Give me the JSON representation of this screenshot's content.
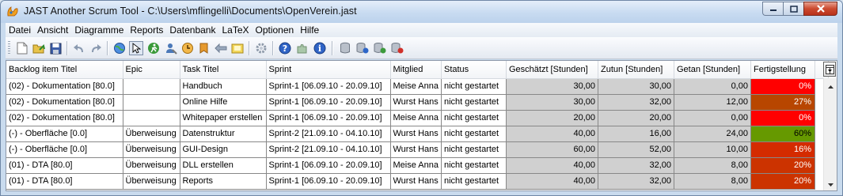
{
  "window": {
    "title": "JAST Another Scrum Tool  -  C:\\Users\\mflingelli\\Documents\\OpenVerein.jast"
  },
  "colors": {
    "titlebar": "#c8dbf1",
    "numeric_cell_bg": "#d0d0d0",
    "progress_0": "#ff0000",
    "progress_16": "#d42b00",
    "progress_20": "#cc3300",
    "progress_27": "#b84600",
    "progress_60": "#669900"
  },
  "menu": [
    "Datei",
    "Ansicht",
    "Diagramme",
    "Reports",
    "Datenbank",
    "LaTeX",
    "Optionen",
    "Hilfe"
  ],
  "toolbar": {
    "icons": [
      "new-file-icon",
      "open-folder-icon",
      "save-icon",
      "undo-icon",
      "redo-icon",
      "globe-icon",
      "cursor-select-icon",
      "run-person-icon",
      "user-config-icon",
      "clock-icon",
      "bookmark-icon",
      "transfer-icon",
      "folder-note-icon",
      "gear-icon",
      "help-icon",
      "puzzle-icon",
      "info-icon",
      "database-icon",
      "database-add-icon",
      "database-refresh-icon",
      "database-delete-icon"
    ]
  },
  "table": {
    "headers": [
      "Backlog item Titel",
      "Epic",
      "Task Titel",
      "Sprint",
      "Mitglied",
      "Status",
      "Geschätzt [Stunden]",
      "Zutun [Stunden]",
      "Getan [Stunden]",
      "Fertigstellung"
    ],
    "rows": [
      {
        "backlog": "(02) - Dokumentation [80.0]",
        "epic": "",
        "task": "Handbuch",
        "sprint": "Sprint-1 [06.09.10 - 20.09.10]",
        "member": "Meise Anna",
        "status": "nicht gestartet",
        "estimated": "30,00",
        "todo": "30,00",
        "done": "0,00",
        "progress": "0%",
        "progress_value": 0,
        "progress_color": "#ff0000"
      },
      {
        "backlog": "(02) - Dokumentation [80.0]",
        "epic": "",
        "task": "Online Hilfe",
        "sprint": "Sprint-1 [06.09.10 - 20.09.10]",
        "member": "Wurst Hans",
        "status": "nicht gestartet",
        "estimated": "30,00",
        "todo": "32,00",
        "done": "12,00",
        "progress": "27%",
        "progress_value": 27,
        "progress_color": "#b84600"
      },
      {
        "backlog": "(02) - Dokumentation [80.0]",
        "epic": "",
        "task": "Whitepaper erstellen",
        "sprint": "Sprint-1 [06.09.10 - 20.09.10]",
        "member": "Meise Anna",
        "status": "nicht gestartet",
        "estimated": "20,00",
        "todo": "20,00",
        "done": "0,00",
        "progress": "0%",
        "progress_value": 0,
        "progress_color": "#ff0000"
      },
      {
        "backlog": "(-) - Oberfläche [0.0]",
        "epic": "Überweisung",
        "task": "Datenstruktur",
        "sprint": "Sprint-2 [21.09.10 - 04.10.10]",
        "member": "Wurst Hans",
        "status": "nicht gestartet",
        "estimated": "40,00",
        "todo": "16,00",
        "done": "24,00",
        "progress": "60%",
        "progress_value": 60,
        "progress_color": "#669900"
      },
      {
        "backlog": "(-) - Oberfläche [0.0]",
        "epic": "Überweisung",
        "task": "GUI-Design",
        "sprint": "Sprint-2 [21.09.10 - 04.10.10]",
        "member": "Wurst Hans",
        "status": "nicht gestartet",
        "estimated": "60,00",
        "todo": "52,00",
        "done": "10,00",
        "progress": "16%",
        "progress_value": 16,
        "progress_color": "#d42b00"
      },
      {
        "backlog": "(01) - DTA [80.0]",
        "epic": "Überweisung",
        "task": "DLL erstellen",
        "sprint": "Sprint-1 [06.09.10 - 20.09.10]",
        "member": "Meise Anna",
        "status": "nicht gestartet",
        "estimated": "40,00",
        "todo": "32,00",
        "done": "8,00",
        "progress": "20%",
        "progress_value": 20,
        "progress_color": "#cc3300"
      },
      {
        "backlog": "(01) - DTA [80.0]",
        "epic": "Überweisung",
        "task": "Reports",
        "sprint": "Sprint-1 [06.09.10 - 20.09.10]",
        "member": "Wurst Hans",
        "status": "nicht gestartet",
        "estimated": "40,00",
        "todo": "32,00",
        "done": "8,00",
        "progress": "20%",
        "progress_value": 20,
        "progress_color": "#cc3300"
      }
    ]
  }
}
